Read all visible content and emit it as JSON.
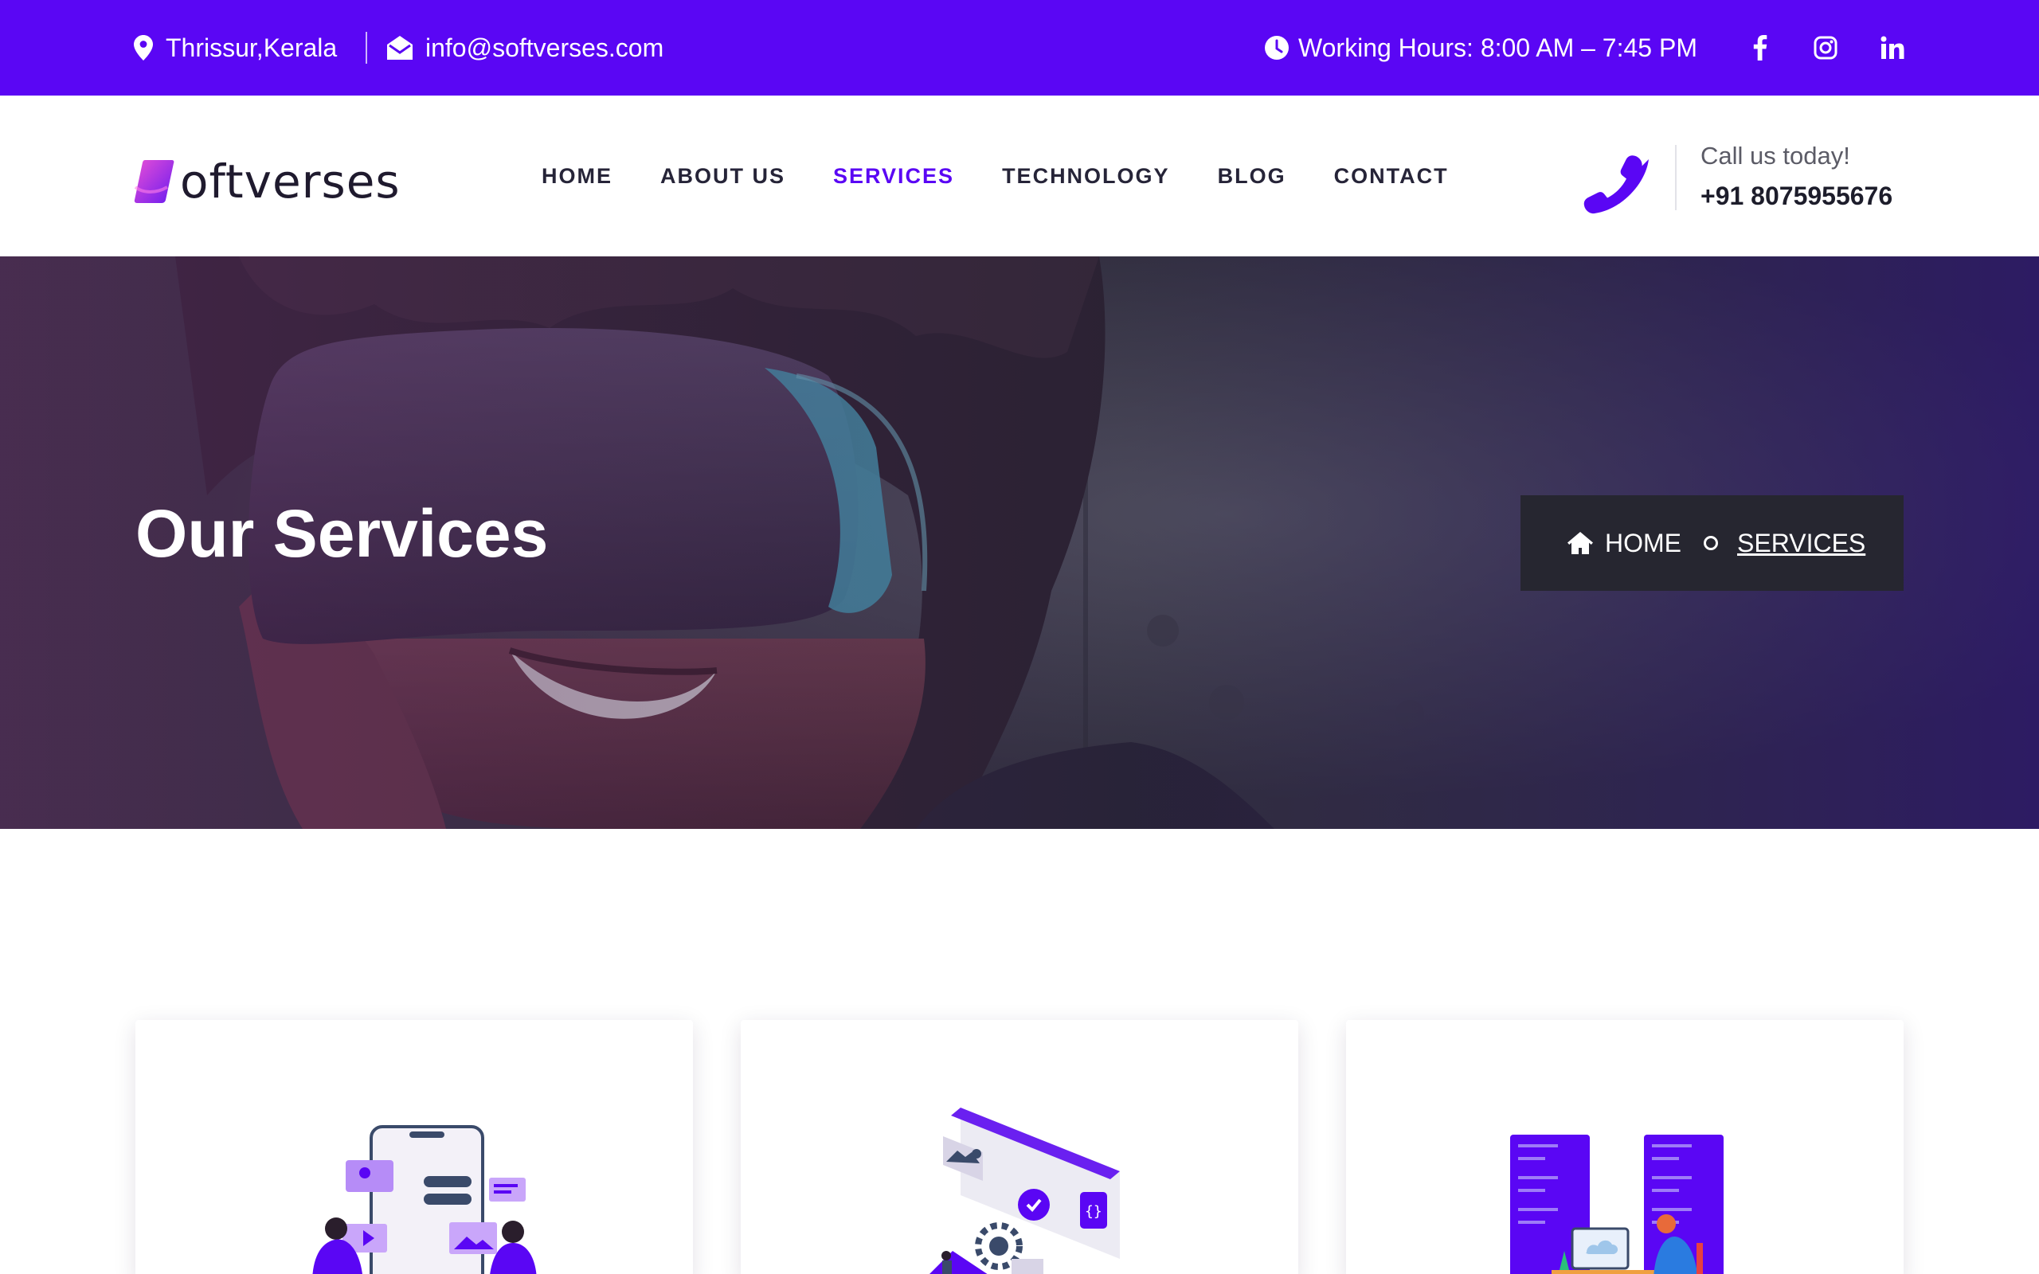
{
  "topbar": {
    "location": "Thrissur,Kerala",
    "email": "info@softverses.com",
    "hours": "Working Hours: 8:00 AM – 7:45 PM",
    "social": [
      "facebook-icon",
      "instagram-icon",
      "linkedin-icon"
    ]
  },
  "header": {
    "logo_text": "oftverses",
    "nav": [
      "HOME",
      "ABOUT US",
      "SERVICES",
      "TECHNOLOGY",
      "BLOG",
      "CONTACT"
    ],
    "active_nav": "SERVICES",
    "call_label": "Call us today!",
    "call_number": "+91 8075955676"
  },
  "hero": {
    "title": "Our Services",
    "breadcrumb_home": "HOME",
    "breadcrumb_current": "SERVICES"
  },
  "services": {
    "cards": [
      "mobile-app-illustration",
      "web-development-illustration",
      "server-hosting-illustration"
    ]
  },
  "colors": {
    "brand": "#5a06f4",
    "text_dark": "#1c1c2b",
    "breadcrumb_bg": "#262630"
  }
}
